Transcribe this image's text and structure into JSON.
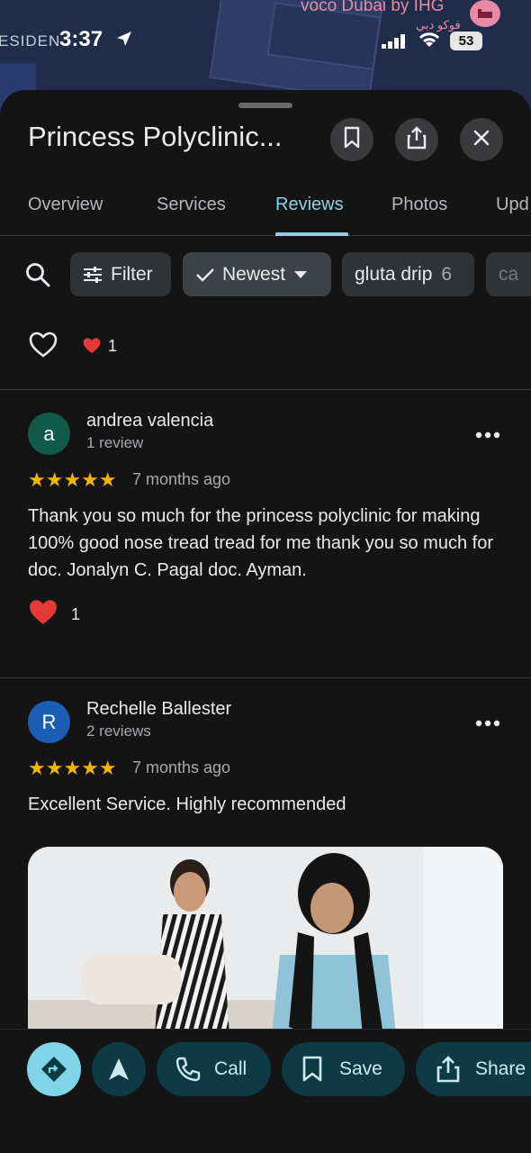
{
  "map": {
    "hotel_label": "voco Dubai by IHG",
    "hotel_label_ar": "فوكو دبي",
    "area_label": "ESIDEN"
  },
  "status_bar": {
    "time": "3:37",
    "battery": "53"
  },
  "place": {
    "title": "Princess Polyclinic..."
  },
  "tabs": [
    {
      "label": "Overview",
      "active": false
    },
    {
      "label": "Services",
      "active": false
    },
    {
      "label": "Reviews",
      "active": true
    },
    {
      "label": "Photos",
      "active": false
    },
    {
      "label": "Upd",
      "active": false
    }
  ],
  "chips": {
    "filter": "Filter",
    "sort": "Newest",
    "topic": "gluta drip",
    "topic_count": "6",
    "next": "ca"
  },
  "summary_reactions": {
    "heart_count": "1"
  },
  "reviews": [
    {
      "avatar_letter": "a",
      "avatar_color": "#0f5a4a",
      "name": "andrea valencia",
      "review_count": "1 review",
      "stars": "★★★★★",
      "rating": 5,
      "time_ago": "7 months ago",
      "text": "Thank you so much for the princess polyclinic for making 100% good nose tread tread for me  thank you so much for doc. Jonalyn C. Pagal doc. Ayman.",
      "likes": "1"
    },
    {
      "avatar_letter": "R",
      "avatar_color": "#1a5fb4",
      "name": "Rechelle Ballester",
      "review_count": "2 reviews",
      "stars": "★★★★★",
      "rating": 5,
      "time_ago": "7 months ago",
      "text": "Excellent Service. Highly recommended"
    }
  ],
  "bottom_bar": {
    "call": "Call",
    "save": "Save",
    "share": "Share"
  },
  "colors": {
    "accent": "#8ad3e8",
    "star": "#f4b400",
    "heart": "#e53935",
    "directions_button": "#7fd4e6"
  }
}
